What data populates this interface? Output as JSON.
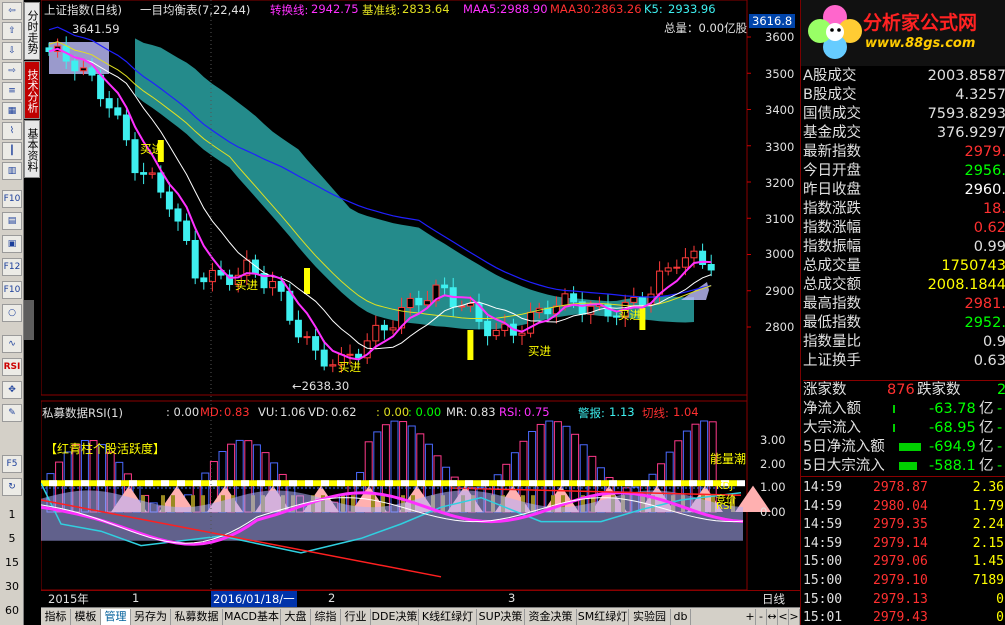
{
  "header": {
    "index_name": "上证指数(日线)",
    "indicator_name": "一目均衡表(7,22,44)",
    "conversion_label": "转换线:",
    "conversion_value": "2942.75",
    "base_label": "基准线:",
    "base_value": "2833.64",
    "maa5_label": "MAA5:",
    "maa5_value": "2988.90",
    "maa30_label": "MAA30:",
    "maa30_value": "2863.26",
    "k5_label": "K5:",
    "k5_value": "2933.96",
    "total_volume": "总量：0.00亿股",
    "high_label": "3641.59",
    "low_label": "←2638.30",
    "price_tag": "3616.8",
    "buy_labels": [
      "买进",
      "买进",
      "买进",
      "买进",
      "买进"
    ]
  },
  "price_axis": [
    "3600",
    "3500",
    "3400",
    "3300",
    "3200",
    "3100",
    "3000",
    "2900",
    "2800"
  ],
  "sub_header": {
    "name": "私募数据RSI(1)",
    "v1": ": 0.00",
    "md_label": "MD:",
    "md_value": "0.83",
    "vu_label": "VU:",
    "vu_value": "1.06",
    "vd_label": "VD:",
    "vd_value": "0.62",
    "v2": ": 0.00",
    "v3": ": 0.00",
    "mr_label": "MR:",
    "mr_value": "0.83",
    "rsi_label": "RSI:",
    "rsi_value": "0.75",
    "alarm_label": "警报:",
    "alarm_value": "1.13",
    "cut_label": "切线:",
    "cut_value": "1.04",
    "panel_title": "【红青柱个股活跃度】",
    "energy_tide": "能量潮",
    "kdj": "KDJ",
    "bid_label": "竞价",
    "rsi_tag": "RSI"
  },
  "sub_axis": [
    "3.00",
    "2.00",
    "1.00",
    "0.00"
  ],
  "date_bar": {
    "year": "2015年",
    "month1": "1",
    "date": "2016/01/18/一",
    "month2": "2",
    "month3": "3",
    "period": "日线"
  },
  "left_toolbar": {
    "tabs": [
      "分时走势",
      "技术分析",
      "基本资料"
    ],
    "numbers": [
      "1",
      "5",
      "15",
      "30",
      "60"
    ],
    "rsi_tag": "RSI"
  },
  "bottom_tabs": [
    "指标",
    "模板",
    "管理",
    "另存为",
    "私募数据",
    "MACD基本",
    "大盘",
    "综指",
    "行业",
    "DDE决策",
    "K线红绿灯",
    "SUP决策",
    "资金决策",
    "SM红绿灯",
    "实验园",
    "db"
  ],
  "bottom_controls": [
    "+",
    "-",
    "↔",
    "<",
    ">"
  ],
  "logo": {
    "title": "分析家公式网",
    "url": "www.88gs.com"
  },
  "right_panel": {
    "stats": [
      {
        "label": "A股成交",
        "value": "2003.8587",
        "color": "#e0e0e0"
      },
      {
        "label": "B股成交",
        "value": "4.3257",
        "color": "#e0e0e0"
      },
      {
        "label": "国债成交",
        "value": "7593.8293",
        "color": "#e0e0e0"
      },
      {
        "label": "基金成交",
        "value": "376.9297",
        "color": "#e0e0e0"
      },
      {
        "label": "最新指数",
        "value": "2979.",
        "color": "#ff3030"
      },
      {
        "label": "今日开盘",
        "value": "2956.",
        "color": "#00ff00"
      },
      {
        "label": "昨日收盘",
        "value": "2960.",
        "color": "#ffffff"
      },
      {
        "label": "指数涨跌",
        "value": "18.",
        "color": "#ff3030"
      },
      {
        "label": "指数涨幅",
        "value": "0.62",
        "color": "#ff3030"
      },
      {
        "label": "指数振幅",
        "value": "0.99",
        "color": "#e0e0e0"
      },
      {
        "label": "总成交量",
        "value": "1750743",
        "color": "#ffff00"
      },
      {
        "label": "总成交额",
        "value": "2008.1844",
        "color": "#ffff00"
      },
      {
        "label": "最高指数",
        "value": "2981.",
        "color": "#ff3030"
      },
      {
        "label": "最低指数",
        "value": "2952.",
        "color": "#00ff00"
      },
      {
        "label": "指数量比",
        "value": "0.9",
        "color": "#e0e0e0"
      },
      {
        "label": "上证换手",
        "value": "0.63",
        "color": "#e0e0e0"
      }
    ],
    "rise_fall": {
      "up_label": "涨家数",
      "up_value": "876",
      "down_label": "跌家数",
      "down_value": "2"
    },
    "flows": [
      {
        "label": "净流入额",
        "value": "-63.78",
        "unit": "亿"
      },
      {
        "label": "大宗流入",
        "value": "-68.95",
        "unit": "亿"
      },
      {
        "label": "5日净流入额",
        "value": "-694.9",
        "unit": "亿"
      },
      {
        "label": "5日大宗流入",
        "value": "-588.1",
        "unit": "亿"
      }
    ],
    "ticks": [
      {
        "time": "14:59",
        "price": "2978.87",
        "vol": "2.36"
      },
      {
        "time": "14:59",
        "price": "2980.04",
        "vol": "1.79"
      },
      {
        "time": "14:59",
        "price": "2979.35",
        "vol": "2.24"
      },
      {
        "time": "14:59",
        "price": "2979.14",
        "vol": "2.15"
      },
      {
        "time": "15:00",
        "price": "2979.06",
        "vol": "1.45"
      },
      {
        "time": "15:00",
        "price": "2979.10",
        "vol": "7189"
      },
      {
        "time": "15:00",
        "price": "2979.13",
        "vol": "0"
      },
      {
        "time": "15:01",
        "price": "2979.43",
        "vol": "0"
      }
    ]
  },
  "colors": {
    "up": "#ff3b3b",
    "down": "#3ef0f0",
    "cloud": "#2aa3a3",
    "ma_magenta": "#ff30ff",
    "ma_white": "#ffffff",
    "ma_yellow": "#e0e020",
    "ma_blue": "#2020ff",
    "border_red": "#8a0000"
  }
}
